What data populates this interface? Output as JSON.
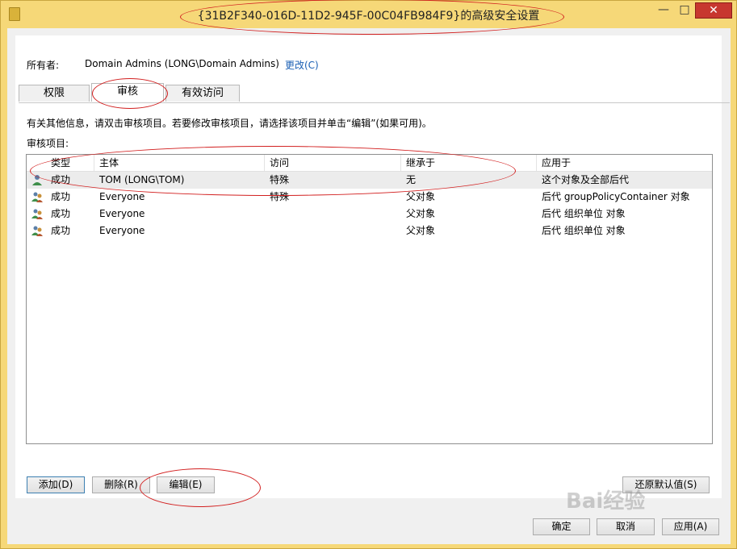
{
  "window": {
    "title": "{31B2F340-016D-11D2-945F-00C04FB984F9}的高级安全设置",
    "minimize": "—",
    "maximize": "□",
    "close": "✕"
  },
  "owner": {
    "label": "所有者:",
    "value": "Domain Admins (LONG\\Domain Admins)",
    "change_link": "更改(C)"
  },
  "tabs": [
    {
      "label": "权限"
    },
    {
      "label": "审核",
      "active": true
    },
    {
      "label": "有效访问"
    }
  ],
  "info_text": "有关其他信息，请双击审核项目。若要修改审核项目，请选择该项目并单击“编辑”(如果可用)。",
  "items_label": "审核项目:",
  "table": {
    "columns": [
      "类型",
      "主体",
      "访问",
      "继承于",
      "应用于"
    ],
    "rows": [
      {
        "type": "成功",
        "principal": "TOM (LONG\\TOM)",
        "access": "特殊",
        "inherited": "无",
        "applies": "这个对象及全部后代"
      },
      {
        "type": "成功",
        "principal": "Everyone",
        "access": "特殊",
        "inherited": "父对象",
        "applies": "后代 groupPolicyContainer 对象"
      },
      {
        "type": "成功",
        "principal": "Everyone",
        "access": "",
        "inherited": "父对象",
        "applies": "后代 组织单位 对象"
      },
      {
        "type": "成功",
        "principal": "Everyone",
        "access": "",
        "inherited": "父对象",
        "applies": "后代 组织单位 对象"
      }
    ]
  },
  "buttons": {
    "add": "添加(D)",
    "remove": "删除(R)",
    "edit": "编辑(E)",
    "restore": "还原默认值(S)",
    "ok": "确定",
    "cancel": "取消",
    "apply": "应用(A)"
  },
  "watermark": "Bai经验",
  "colors": {
    "title_bar": "#f6d878",
    "annotation": "#d21f1f",
    "link": "#1a5fb4",
    "close_button": "#c7372f"
  }
}
